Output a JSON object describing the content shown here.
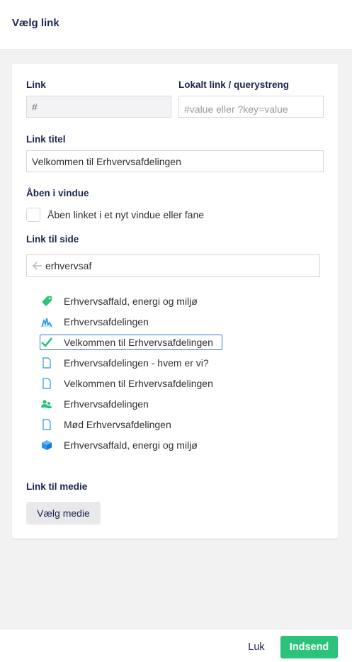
{
  "header": {
    "title": "Vælg link"
  },
  "form": {
    "link_label": "Link",
    "link_value": "#",
    "anchor_label": "Lokalt link / querystreng",
    "anchor_placeholder": "#value eller ?key=value",
    "title_label": "Link titel",
    "title_value": "Velkommen til Erhvervsafdelingen",
    "target_label": "Åben i vindue",
    "target_checkbox_label": "Åben linket i et nyt vindue eller fane",
    "target_checked": false,
    "page_label": "Link til side",
    "search_value": "erhvervsaf",
    "media_label": "Link til medie",
    "media_button": "Vælg medie"
  },
  "results": [
    {
      "label": "Erhvervsaffald, energi og miljø",
      "icon": "tag-icon",
      "color": "#2bc37c"
    },
    {
      "label": "Erhvervsafdelingen",
      "icon": "chart-icon",
      "color": "#2196f3"
    },
    {
      "label": "Velkommen til Erhvervsafdelingen",
      "icon": "check-icon",
      "color": "#2bc37c",
      "selected": true
    },
    {
      "label": "Erhvervsafdelingen - hvem er vi?",
      "icon": "document-icon",
      "color": "#2196f3"
    },
    {
      "label": "Velkommen til Erhvervsafdelingen",
      "icon": "document-icon",
      "color": "#2196f3"
    },
    {
      "label": "Erhvervsafdelingen",
      "icon": "users-icon",
      "color": "#2bc37c"
    },
    {
      "label": "Mød Erhvervsafdelingen",
      "icon": "document-icon",
      "color": "#2196f3"
    },
    {
      "label": "Erhvervsaffald, energi og miljø",
      "icon": "box-icon",
      "color": "#2196f3"
    }
  ],
  "footer": {
    "close_label": "Luk",
    "submit_label": "Indsend"
  },
  "colors": {
    "accent": "#2bc37c",
    "focus": "#3879d9",
    "text": "#1b264f",
    "icon_blue": "#2196f3"
  }
}
